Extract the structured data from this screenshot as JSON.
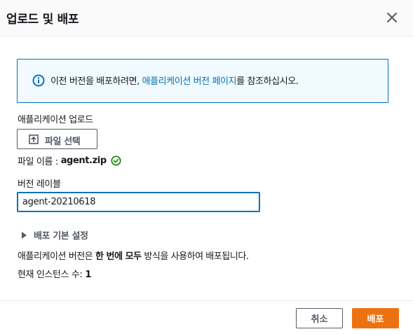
{
  "modal": {
    "title": "업로드 및 배포"
  },
  "info": {
    "text_before": "이전 버전을 배포하려면, ",
    "link_text": "애플리케이션 버전 페이지",
    "text_after": "를 참조하십시오."
  },
  "upload": {
    "label": "애플리케이션 업로드",
    "button_label": "파일 선택",
    "filename_label": "파일 이름 :",
    "filename_value": "agent.zip"
  },
  "version": {
    "label": "버전 레이블",
    "value": "agent-20210618"
  },
  "deploy_settings": {
    "expander_label": "배포 기본 설정",
    "description_before": "애플리케이션 버전은 ",
    "description_bold": "한 번에 모두",
    "description_after": " 방식을 사용하여 배포됩니다.",
    "instance_label": "현재 인스턴스 수:",
    "instance_count": "1"
  },
  "footer": {
    "cancel_label": "취소",
    "deploy_label": "배포"
  },
  "colors": {
    "accent": "#0073bb",
    "primary_button": "#ec7211",
    "success": "#1d8102"
  },
  "icons": {
    "close": "close-icon",
    "info": "info-icon",
    "upload": "upload-icon",
    "check": "check-circle-icon",
    "expander": "caret-right-icon"
  }
}
